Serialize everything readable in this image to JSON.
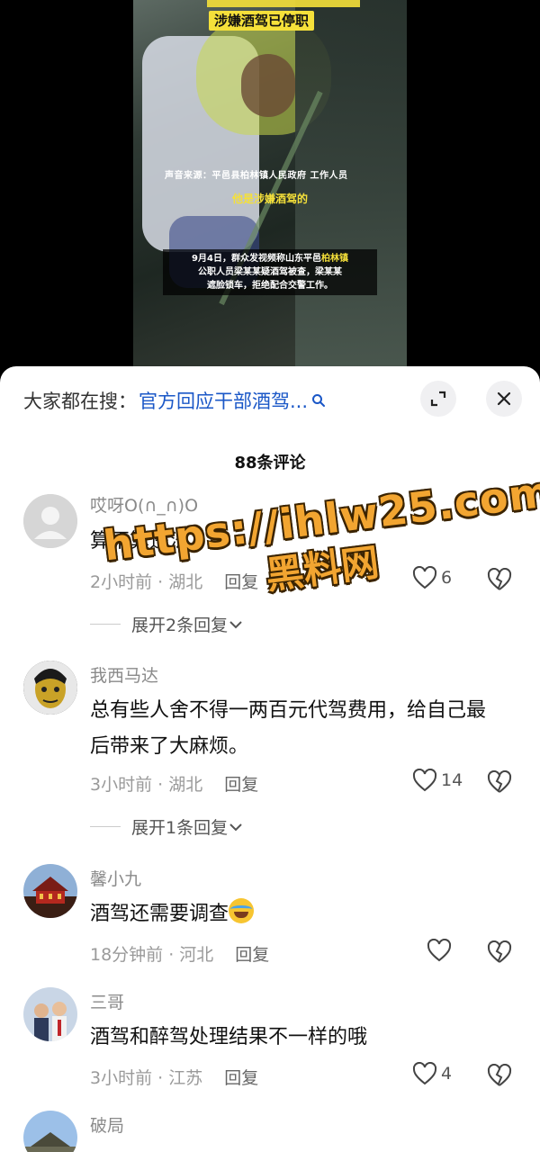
{
  "video": {
    "caption_top": "涉嫌酒驾已停职",
    "caption_source": "声音来源：平邑县柏林镇人民政府  工作人员",
    "caption_quote": "他是涉嫌酒驾的",
    "caption_box_line1_a": "9月4日，群众发视频称山东平邑",
    "caption_box_line1_b": "柏林镇",
    "caption_box_line2": "公职人员梁某某疑酒驾被查，梁某某",
    "caption_box_line3": "遮脸锁车，拒绝配合交警工作。"
  },
  "sheet": {
    "search_label": "大家都在搜：",
    "search_query": "官方回应干部酒驾...",
    "comment_count": "88条评论"
  },
  "comments": [
    {
      "name": "哎呀O(∩_∩)O",
      "text": "算不算违法",
      "meta": "2小时前 · 湖北",
      "reply": "回复",
      "likes": "6",
      "expand": "展开2条回复"
    },
    {
      "name": "我西马达",
      "text": "总有些人舍不得一两百元代驾费用，给自己最后带来了大麻烦。",
      "meta": "3小时前 · 湖北",
      "reply": "回复",
      "likes": "14",
      "expand": "展开1条回复"
    },
    {
      "name": "馨小九",
      "text": "酒驾还需要调查",
      "meta": "18分钟前 · 河北",
      "reply": "回复",
      "likes": ""
    },
    {
      "name": "三哥",
      "text": "酒驾和醉驾处理结果不一样的哦",
      "meta": "3小时前 · 江苏",
      "reply": "回复",
      "likes": "4"
    },
    {
      "name": "破局"
    }
  ],
  "watermark": {
    "url": "https://ihlw25.com",
    "cn": "黑料网"
  },
  "icons": {
    "search": "search-icon",
    "expand": "expand-screen-icon",
    "close": "close-icon",
    "like": "heart-icon",
    "dislike": "broken-heart-icon",
    "chevron": "chevron-down-icon"
  },
  "colors": {
    "link_blue": "#1a57c7",
    "caption_yellow": "#f5e03a",
    "watermark_orange": "#f2a531"
  }
}
